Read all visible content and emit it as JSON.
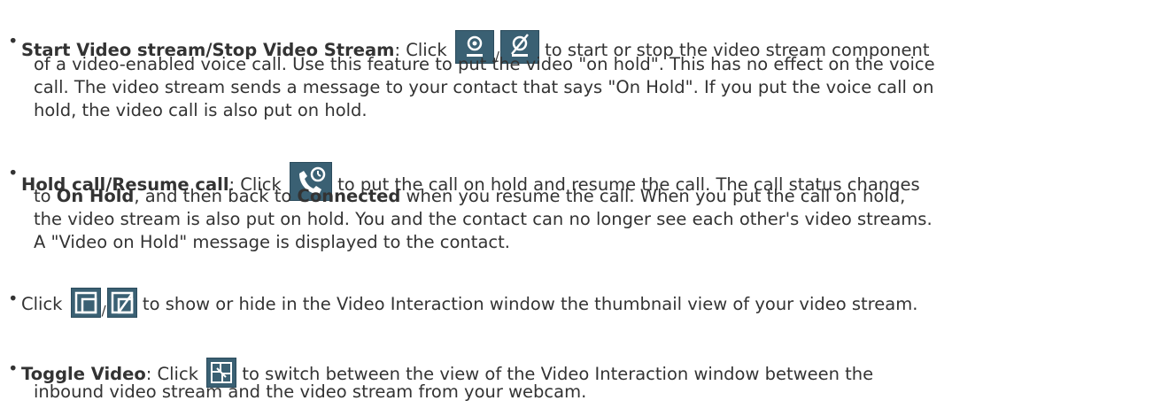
{
  "items": [
    {
      "title_a": "Start Video stream",
      "sep": "/",
      "title_b": "Stop Video Stream",
      "click": ": Click",
      "icon_slash": "/",
      "line1_rest": " to start or stop the video stream component",
      "line2": "of a video-enabled voice call. Use this feature to put the video \"on hold\". This has no effect on the voice",
      "line3": "call. The video stream sends a message to your contact that says \"On Hold\". If you put the voice call on",
      "line4": "hold, the video call is also put on hold.",
      "icons": [
        "webcam-icon",
        "webcam-off-icon"
      ]
    },
    {
      "title_a": "Hold call",
      "sep": "/",
      "title_b": "Resume call",
      "click": ": Click",
      "line1_rest": " to put the call on hold and resume the call. The call status changes",
      "line2_pre": "to ",
      "line2_b1": "On Hold",
      "line2_mid": ", and then back to ",
      "line2_b2": "Connected",
      "line2_post": " when you resume the call. When you put the call on hold,",
      "line3": "the video stream is also put on hold. You and the contact can no longer see each other's video streams.",
      "line4": "A \"Video on Hold\" message is displayed to the contact.",
      "icons": [
        "phone-hold-icon"
      ]
    },
    {
      "click": "Click",
      "icon_slash": "/",
      "line1_rest": " to show or hide in the Video Interaction window the thumbnail view of your video stream.",
      "icons": [
        "thumbnail-show-icon",
        "thumbnail-hide-icon"
      ]
    },
    {
      "title_a": "Toggle Video",
      "click": ": Click",
      "line1_rest": " to switch between the view of the Video Interaction window between the",
      "line2": "inbound video stream and the video stream from your webcam.",
      "icons": [
        "toggle-video-icon"
      ]
    }
  ],
  "bullet_char": "•",
  "colors": {
    "text": "#333333",
    "icon_bg": "#3a6073"
  }
}
